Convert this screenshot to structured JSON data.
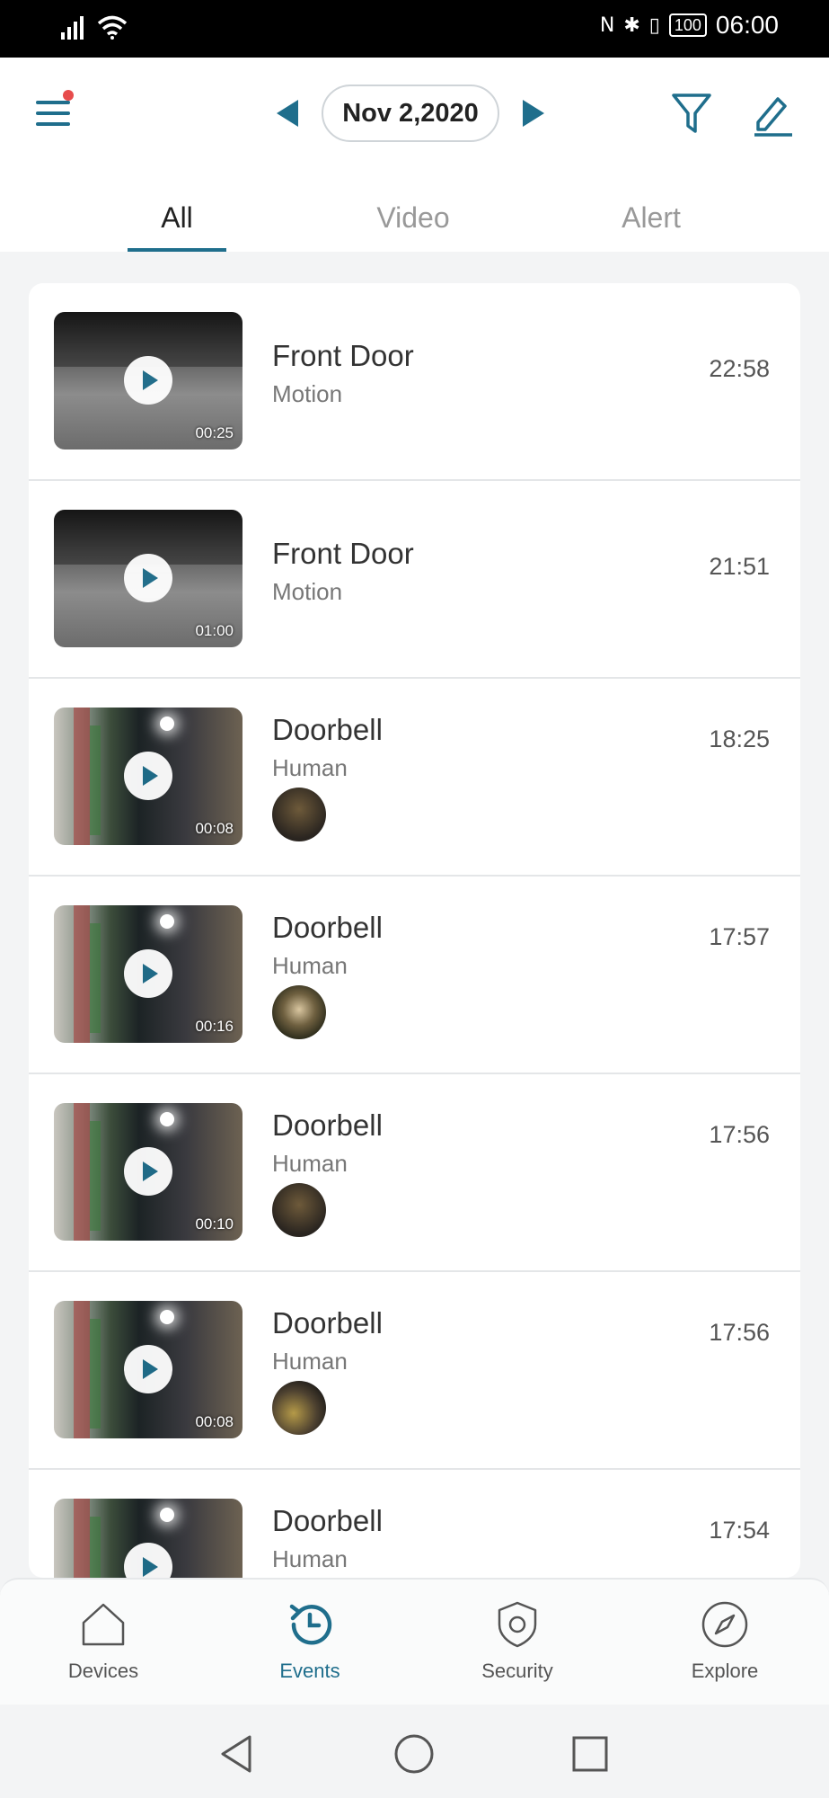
{
  "status_bar": {
    "battery": "100",
    "time": "06:00"
  },
  "header": {
    "date": "Nov 2,2020",
    "tabs": [
      {
        "label": "All",
        "active": true
      },
      {
        "label": "Video",
        "active": false
      },
      {
        "label": "Alert",
        "active": false
      }
    ]
  },
  "events": [
    {
      "title": "Front Door",
      "type": "Motion",
      "time": "22:58",
      "duration": "00:25",
      "thumb": "night-gray",
      "has_avatar": false
    },
    {
      "title": "Front Door",
      "type": "Motion",
      "time": "21:51",
      "duration": "01:00",
      "thumb": "night-gray",
      "has_avatar": false
    },
    {
      "title": "Doorbell",
      "type": "Human",
      "time": "18:25",
      "duration": "00:08",
      "thumb": "doorbell",
      "has_avatar": true
    },
    {
      "title": "Doorbell",
      "type": "Human",
      "time": "17:57",
      "duration": "00:16",
      "thumb": "doorbell",
      "has_avatar": true
    },
    {
      "title": "Doorbell",
      "type": "Human",
      "time": "17:56",
      "duration": "00:10",
      "thumb": "doorbell",
      "has_avatar": true
    },
    {
      "title": "Doorbell",
      "type": "Human",
      "time": "17:56",
      "duration": "00:08",
      "thumb": "doorbell",
      "has_avatar": true
    },
    {
      "title": "Doorbell",
      "type": "Human",
      "time": "17:54",
      "duration": "",
      "thumb": "doorbell",
      "has_avatar": true
    }
  ],
  "bottom_nav": [
    {
      "label": "Devices",
      "icon": "home-icon",
      "active": false
    },
    {
      "label": "Events",
      "icon": "history-icon",
      "active": true
    },
    {
      "label": "Security",
      "icon": "shield-icon",
      "active": false
    },
    {
      "label": "Explore",
      "icon": "compass-icon",
      "active": false
    }
  ],
  "colors": {
    "accent": "#1f6e8c",
    "notification_dot": "#e74c4c",
    "background": "#f3f4f5"
  }
}
